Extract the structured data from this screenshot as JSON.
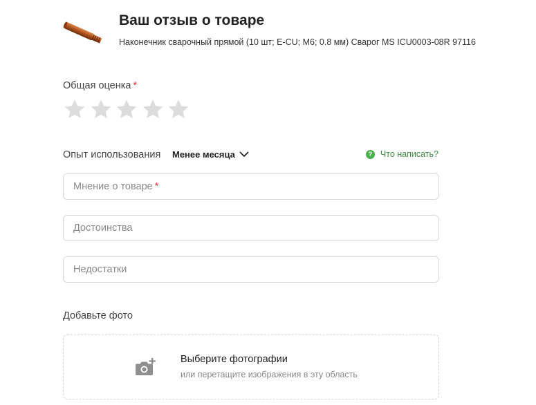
{
  "header": {
    "title": "Ваш отзыв о товаре",
    "product_name": "Наконечник сварочный прямой (10 шт; E-CU; M6; 0.8 мм) Сварог MS ICU0003-08R 97116",
    "thumbnail_icon": "welding-tip-image"
  },
  "rating": {
    "label": "Общая оценка",
    "required_mark": "*",
    "max_stars": 5,
    "selected": 0,
    "star_color_empty": "#dcdcdc"
  },
  "experience": {
    "label": "Опыт использования",
    "selected_value": "Менее месяца",
    "help_icon_glyph": "?",
    "help_text": "Что написать?",
    "help_color": "#4caf50"
  },
  "fields": {
    "opinion": {
      "placeholder": "Мнение о товаре",
      "required_mark": "*",
      "value": ""
    },
    "pros": {
      "placeholder": "Достоинства",
      "value": ""
    },
    "cons": {
      "placeholder": "Недостатки",
      "value": ""
    }
  },
  "photo": {
    "label": "Добавьте фото",
    "dropzone_title": "Выберите фотографии",
    "dropzone_subtitle": "или перетащите изображения в эту область",
    "icon": "camera-add-icon"
  },
  "colors": {
    "required": "#e53935",
    "accent_green": "#4caf50",
    "border": "#d9d9d9"
  }
}
